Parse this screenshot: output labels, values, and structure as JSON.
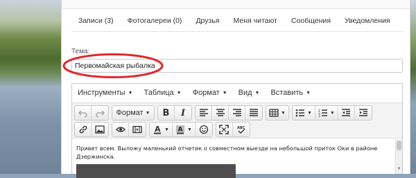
{
  "tabs": [
    {
      "label": "Записи (3)"
    },
    {
      "label": "Фотогалереи (0)"
    },
    {
      "label": "Друзья"
    },
    {
      "label": "Меня читают"
    },
    {
      "label": "Сообщения"
    },
    {
      "label": "Уведомления"
    }
  ],
  "form": {
    "theme_label": "Тема:",
    "title_value": "Первомайская рыбалка"
  },
  "editor": {
    "menu": [
      {
        "label": "Инструменты"
      },
      {
        "label": "Таблица"
      },
      {
        "label": "Формат"
      },
      {
        "label": "Вид"
      },
      {
        "label": "Вставить"
      }
    ],
    "format_dropdown": "Формат",
    "content_text": "Привет всем. Выложу маленький отчетик о совместном выезде на небольшой приток Оки в районе Дзержинска."
  },
  "colors": {
    "highlight_ellipse": "#e2262b",
    "panel_bg": "#ffffff",
    "toolbar_bg": "#f3f3f3"
  }
}
